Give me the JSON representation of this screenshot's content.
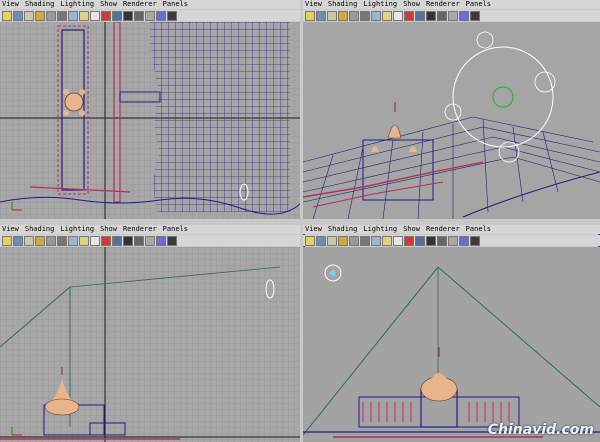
{
  "menu_labels": [
    "View",
    "Shading",
    "Lighting",
    "Show",
    "Renderer",
    "Panels"
  ],
  "panes": [
    {
      "id": "top-left",
      "active": false
    },
    {
      "id": "top-right",
      "active": false
    },
    {
      "id": "bottom-left",
      "active": false
    },
    {
      "id": "bottom-right",
      "active": true
    }
  ],
  "watermark": "Chinavid.com"
}
